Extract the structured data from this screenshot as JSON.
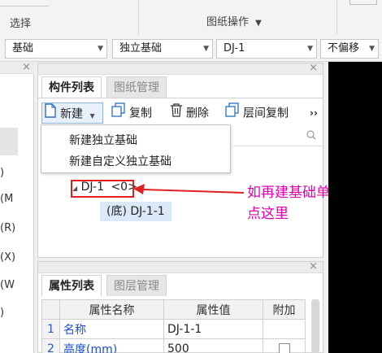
{
  "ribbon": {
    "select_label": "选择",
    "drawing_ops_label": "图纸操作",
    "drawing_ops_arrow": "▼"
  },
  "toolbar_combos": [
    {
      "value": "基础"
    },
    {
      "value": "独立基础"
    },
    {
      "value": "DJ-1"
    },
    {
      "value": "不偏移"
    }
  ],
  "left_panel": {
    "items": [
      ")",
      "(M",
      "(R)",
      "(X)",
      "(W",
      ")"
    ]
  },
  "component_panel": {
    "tabs": [
      {
        "label": "构件列表",
        "active": true
      },
      {
        "label": "图纸管理",
        "active": false
      }
    ],
    "toolbar": {
      "new_label": "新建",
      "copy_label": "复制",
      "delete_label": "删除",
      "floor_copy_label": "层间复制",
      "more_label": "››"
    },
    "new_menu": {
      "items": [
        "新建独立基础",
        "新建自定义独立基础"
      ]
    },
    "tree": {
      "parent_label": "DJ-1",
      "parent_suffix": "<0>",
      "child_label": "(底) DJ-1-1"
    }
  },
  "annotation": {
    "line1": "如再建基础单元",
    "line2": "点这里",
    "color": "#e000b0",
    "box_color": "#e02020"
  },
  "property_panel": {
    "tabs": [
      {
        "label": "属性列表",
        "active": true
      },
      {
        "label": "图层管理",
        "active": false
      }
    ],
    "columns": [
      "属性名称",
      "属性值",
      "附加"
    ],
    "rows": [
      {
        "index": "1",
        "name": "名称",
        "value": "DJ-1-1",
        "extra": ""
      },
      {
        "index": "2",
        "name": "高度(mm)",
        "value": "500",
        "extra": "checkbox"
      }
    ]
  }
}
